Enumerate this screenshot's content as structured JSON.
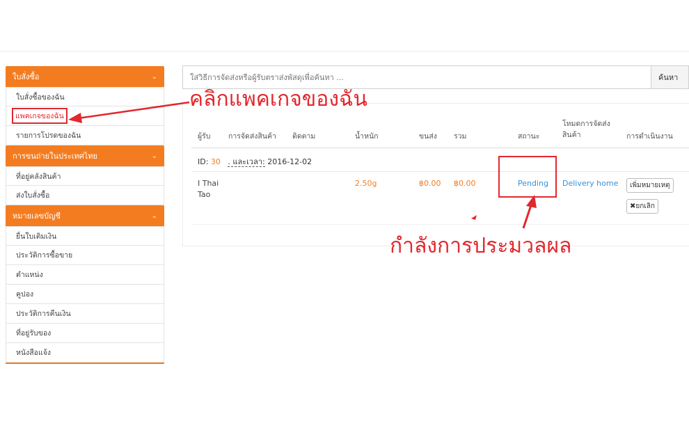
{
  "sidebar": {
    "sections": [
      {
        "title": "ใบสั่งซื้อ",
        "items": [
          "ใบสั่งซื้อของฉัน",
          "แพคเกจของฉัน",
          "รายการโปรดของฉัน"
        ]
      },
      {
        "title": "การขนถ่ายในประเทศไทย",
        "items": [
          "ที่อยู่คลังสินค้า",
          "ส่งใบสั่งซื้อ"
        ]
      },
      {
        "title": "หมายเลขบัญชี",
        "items": [
          "ยื่นใบเติมเงิน",
          "ประวัติการซื้อขาย",
          "ตำแหน่ง",
          "คูปอง",
          "ประวัติการคืนเงิน",
          "ที่อยู่รับของ",
          "หนังสือแจ้ง"
        ]
      }
    ],
    "chevron": "chevron-down-icon"
  },
  "search": {
    "placeholder": "ใส่วิธีการจัดส่งหรือผู้รับตราส่งพัสดุเพื่อค้นหา ...",
    "button": "ค้นหา"
  },
  "table": {
    "headers": [
      "ผู้รับ",
      "การจัดส่งสินค้า",
      "ติดตาม",
      "น้ำหนัก",
      "ขนส่ง",
      "รวม",
      "สถานะ",
      "โหมดการจัดส่ง",
      "สินค้า",
      "การดำเนินงาน"
    ],
    "id_label": "ID:",
    "id_value": "30",
    "date_label": ". และเวลา:",
    "date_value": "2016-12-02",
    "row": {
      "recipient_1": "I Thai",
      "recipient_2": "Tao",
      "weight": "2.50g",
      "shipping": "฿0.00",
      "total": "฿0.00",
      "status": "Pending",
      "delivery_mode": "Delivery home",
      "note_button": "เพิ่มหมายเหตุ",
      "cancel_button": "ยกเลิก"
    }
  },
  "annotations": {
    "click_package": "คลิกแพคเกจของฉัน",
    "processing": "กำลังการประมวลผล",
    "color": "#e0282e"
  },
  "colors": {
    "accent": "#f47c20",
    "link": "#3a8fd6"
  }
}
